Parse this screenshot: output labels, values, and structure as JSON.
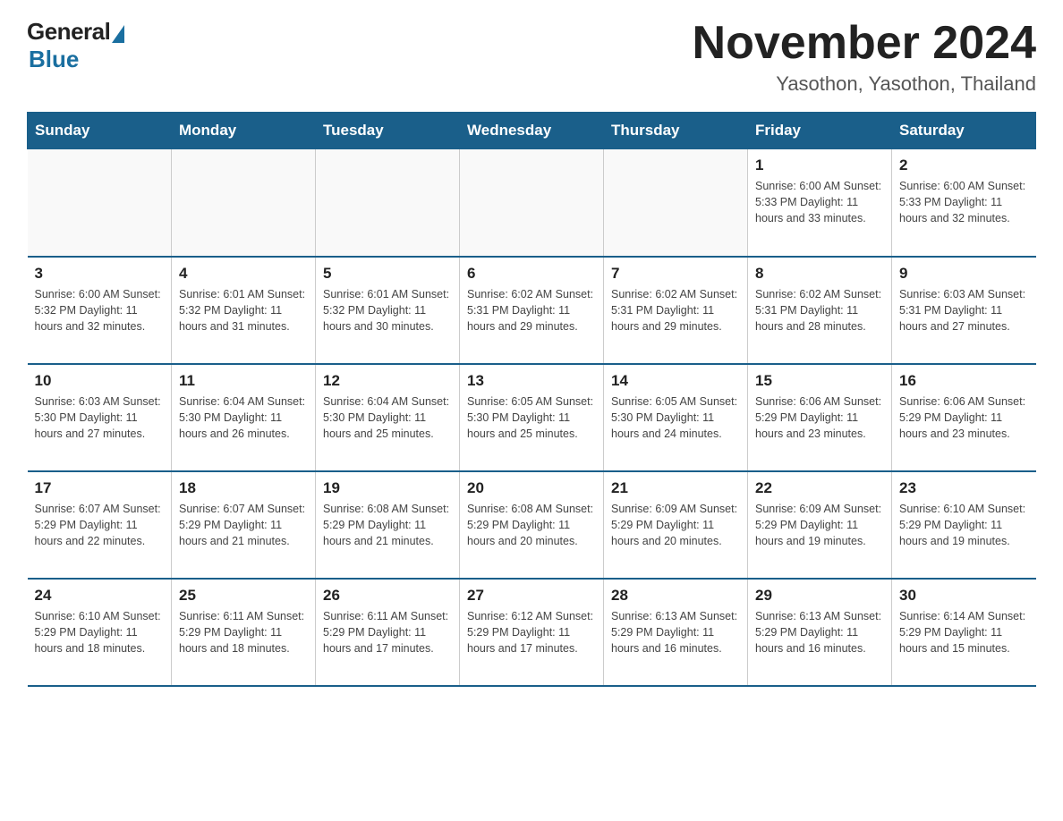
{
  "header": {
    "logo_general": "General",
    "logo_blue": "Blue",
    "title": "November 2024",
    "subtitle": "Yasothon, Yasothon, Thailand"
  },
  "days_of_week": [
    "Sunday",
    "Monday",
    "Tuesday",
    "Wednesday",
    "Thursday",
    "Friday",
    "Saturday"
  ],
  "weeks": [
    [
      {
        "day": "",
        "info": ""
      },
      {
        "day": "",
        "info": ""
      },
      {
        "day": "",
        "info": ""
      },
      {
        "day": "",
        "info": ""
      },
      {
        "day": "",
        "info": ""
      },
      {
        "day": "1",
        "info": "Sunrise: 6:00 AM\nSunset: 5:33 PM\nDaylight: 11 hours and 33 minutes."
      },
      {
        "day": "2",
        "info": "Sunrise: 6:00 AM\nSunset: 5:33 PM\nDaylight: 11 hours and 32 minutes."
      }
    ],
    [
      {
        "day": "3",
        "info": "Sunrise: 6:00 AM\nSunset: 5:32 PM\nDaylight: 11 hours and 32 minutes."
      },
      {
        "day": "4",
        "info": "Sunrise: 6:01 AM\nSunset: 5:32 PM\nDaylight: 11 hours and 31 minutes."
      },
      {
        "day": "5",
        "info": "Sunrise: 6:01 AM\nSunset: 5:32 PM\nDaylight: 11 hours and 30 minutes."
      },
      {
        "day": "6",
        "info": "Sunrise: 6:02 AM\nSunset: 5:31 PM\nDaylight: 11 hours and 29 minutes."
      },
      {
        "day": "7",
        "info": "Sunrise: 6:02 AM\nSunset: 5:31 PM\nDaylight: 11 hours and 29 minutes."
      },
      {
        "day": "8",
        "info": "Sunrise: 6:02 AM\nSunset: 5:31 PM\nDaylight: 11 hours and 28 minutes."
      },
      {
        "day": "9",
        "info": "Sunrise: 6:03 AM\nSunset: 5:31 PM\nDaylight: 11 hours and 27 minutes."
      }
    ],
    [
      {
        "day": "10",
        "info": "Sunrise: 6:03 AM\nSunset: 5:30 PM\nDaylight: 11 hours and 27 minutes."
      },
      {
        "day": "11",
        "info": "Sunrise: 6:04 AM\nSunset: 5:30 PM\nDaylight: 11 hours and 26 minutes."
      },
      {
        "day": "12",
        "info": "Sunrise: 6:04 AM\nSunset: 5:30 PM\nDaylight: 11 hours and 25 minutes."
      },
      {
        "day": "13",
        "info": "Sunrise: 6:05 AM\nSunset: 5:30 PM\nDaylight: 11 hours and 25 minutes."
      },
      {
        "day": "14",
        "info": "Sunrise: 6:05 AM\nSunset: 5:30 PM\nDaylight: 11 hours and 24 minutes."
      },
      {
        "day": "15",
        "info": "Sunrise: 6:06 AM\nSunset: 5:29 PM\nDaylight: 11 hours and 23 minutes."
      },
      {
        "day": "16",
        "info": "Sunrise: 6:06 AM\nSunset: 5:29 PM\nDaylight: 11 hours and 23 minutes."
      }
    ],
    [
      {
        "day": "17",
        "info": "Sunrise: 6:07 AM\nSunset: 5:29 PM\nDaylight: 11 hours and 22 minutes."
      },
      {
        "day": "18",
        "info": "Sunrise: 6:07 AM\nSunset: 5:29 PM\nDaylight: 11 hours and 21 minutes."
      },
      {
        "day": "19",
        "info": "Sunrise: 6:08 AM\nSunset: 5:29 PM\nDaylight: 11 hours and 21 minutes."
      },
      {
        "day": "20",
        "info": "Sunrise: 6:08 AM\nSunset: 5:29 PM\nDaylight: 11 hours and 20 minutes."
      },
      {
        "day": "21",
        "info": "Sunrise: 6:09 AM\nSunset: 5:29 PM\nDaylight: 11 hours and 20 minutes."
      },
      {
        "day": "22",
        "info": "Sunrise: 6:09 AM\nSunset: 5:29 PM\nDaylight: 11 hours and 19 minutes."
      },
      {
        "day": "23",
        "info": "Sunrise: 6:10 AM\nSunset: 5:29 PM\nDaylight: 11 hours and 19 minutes."
      }
    ],
    [
      {
        "day": "24",
        "info": "Sunrise: 6:10 AM\nSunset: 5:29 PM\nDaylight: 11 hours and 18 minutes."
      },
      {
        "day": "25",
        "info": "Sunrise: 6:11 AM\nSunset: 5:29 PM\nDaylight: 11 hours and 18 minutes."
      },
      {
        "day": "26",
        "info": "Sunrise: 6:11 AM\nSunset: 5:29 PM\nDaylight: 11 hours and 17 minutes."
      },
      {
        "day": "27",
        "info": "Sunrise: 6:12 AM\nSunset: 5:29 PM\nDaylight: 11 hours and 17 minutes."
      },
      {
        "day": "28",
        "info": "Sunrise: 6:13 AM\nSunset: 5:29 PM\nDaylight: 11 hours and 16 minutes."
      },
      {
        "day": "29",
        "info": "Sunrise: 6:13 AM\nSunset: 5:29 PM\nDaylight: 11 hours and 16 minutes."
      },
      {
        "day": "30",
        "info": "Sunrise: 6:14 AM\nSunset: 5:29 PM\nDaylight: 11 hours and 15 minutes."
      }
    ]
  ]
}
